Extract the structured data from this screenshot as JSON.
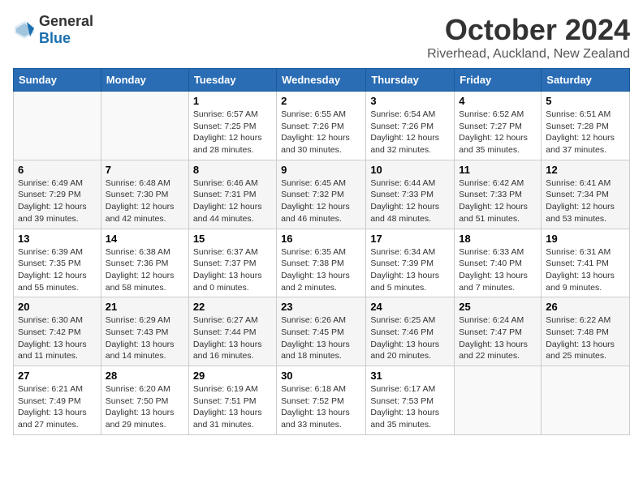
{
  "header": {
    "logo_general": "General",
    "logo_blue": "Blue",
    "title": "October 2024",
    "location": "Riverhead, Auckland, New Zealand"
  },
  "weekdays": [
    "Sunday",
    "Monday",
    "Tuesday",
    "Wednesday",
    "Thursday",
    "Friday",
    "Saturday"
  ],
  "weeks": [
    [
      {
        "day": "",
        "info": ""
      },
      {
        "day": "",
        "info": ""
      },
      {
        "day": "1",
        "info": "Sunrise: 6:57 AM\nSunset: 7:25 PM\nDaylight: 12 hours\nand 28 minutes."
      },
      {
        "day": "2",
        "info": "Sunrise: 6:55 AM\nSunset: 7:26 PM\nDaylight: 12 hours\nand 30 minutes."
      },
      {
        "day": "3",
        "info": "Sunrise: 6:54 AM\nSunset: 7:26 PM\nDaylight: 12 hours\nand 32 minutes."
      },
      {
        "day": "4",
        "info": "Sunrise: 6:52 AM\nSunset: 7:27 PM\nDaylight: 12 hours\nand 35 minutes."
      },
      {
        "day": "5",
        "info": "Sunrise: 6:51 AM\nSunset: 7:28 PM\nDaylight: 12 hours\nand 37 minutes."
      }
    ],
    [
      {
        "day": "6",
        "info": "Sunrise: 6:49 AM\nSunset: 7:29 PM\nDaylight: 12 hours\nand 39 minutes."
      },
      {
        "day": "7",
        "info": "Sunrise: 6:48 AM\nSunset: 7:30 PM\nDaylight: 12 hours\nand 42 minutes."
      },
      {
        "day": "8",
        "info": "Sunrise: 6:46 AM\nSunset: 7:31 PM\nDaylight: 12 hours\nand 44 minutes."
      },
      {
        "day": "9",
        "info": "Sunrise: 6:45 AM\nSunset: 7:32 PM\nDaylight: 12 hours\nand 46 minutes."
      },
      {
        "day": "10",
        "info": "Sunrise: 6:44 AM\nSunset: 7:33 PM\nDaylight: 12 hours\nand 48 minutes."
      },
      {
        "day": "11",
        "info": "Sunrise: 6:42 AM\nSunset: 7:33 PM\nDaylight: 12 hours\nand 51 minutes."
      },
      {
        "day": "12",
        "info": "Sunrise: 6:41 AM\nSunset: 7:34 PM\nDaylight: 12 hours\nand 53 minutes."
      }
    ],
    [
      {
        "day": "13",
        "info": "Sunrise: 6:39 AM\nSunset: 7:35 PM\nDaylight: 12 hours\nand 55 minutes."
      },
      {
        "day": "14",
        "info": "Sunrise: 6:38 AM\nSunset: 7:36 PM\nDaylight: 12 hours\nand 58 minutes."
      },
      {
        "day": "15",
        "info": "Sunrise: 6:37 AM\nSunset: 7:37 PM\nDaylight: 13 hours\nand 0 minutes."
      },
      {
        "day": "16",
        "info": "Sunrise: 6:35 AM\nSunset: 7:38 PM\nDaylight: 13 hours\nand 2 minutes."
      },
      {
        "day": "17",
        "info": "Sunrise: 6:34 AM\nSunset: 7:39 PM\nDaylight: 13 hours\nand 5 minutes."
      },
      {
        "day": "18",
        "info": "Sunrise: 6:33 AM\nSunset: 7:40 PM\nDaylight: 13 hours\nand 7 minutes."
      },
      {
        "day": "19",
        "info": "Sunrise: 6:31 AM\nSunset: 7:41 PM\nDaylight: 13 hours\nand 9 minutes."
      }
    ],
    [
      {
        "day": "20",
        "info": "Sunrise: 6:30 AM\nSunset: 7:42 PM\nDaylight: 13 hours\nand 11 minutes."
      },
      {
        "day": "21",
        "info": "Sunrise: 6:29 AM\nSunset: 7:43 PM\nDaylight: 13 hours\nand 14 minutes."
      },
      {
        "day": "22",
        "info": "Sunrise: 6:27 AM\nSunset: 7:44 PM\nDaylight: 13 hours\nand 16 minutes."
      },
      {
        "day": "23",
        "info": "Sunrise: 6:26 AM\nSunset: 7:45 PM\nDaylight: 13 hours\nand 18 minutes."
      },
      {
        "day": "24",
        "info": "Sunrise: 6:25 AM\nSunset: 7:46 PM\nDaylight: 13 hours\nand 20 minutes."
      },
      {
        "day": "25",
        "info": "Sunrise: 6:24 AM\nSunset: 7:47 PM\nDaylight: 13 hours\nand 22 minutes."
      },
      {
        "day": "26",
        "info": "Sunrise: 6:22 AM\nSunset: 7:48 PM\nDaylight: 13 hours\nand 25 minutes."
      }
    ],
    [
      {
        "day": "27",
        "info": "Sunrise: 6:21 AM\nSunset: 7:49 PM\nDaylight: 13 hours\nand 27 minutes."
      },
      {
        "day": "28",
        "info": "Sunrise: 6:20 AM\nSunset: 7:50 PM\nDaylight: 13 hours\nand 29 minutes."
      },
      {
        "day": "29",
        "info": "Sunrise: 6:19 AM\nSunset: 7:51 PM\nDaylight: 13 hours\nand 31 minutes."
      },
      {
        "day": "30",
        "info": "Sunrise: 6:18 AM\nSunset: 7:52 PM\nDaylight: 13 hours\nand 33 minutes."
      },
      {
        "day": "31",
        "info": "Sunrise: 6:17 AM\nSunset: 7:53 PM\nDaylight: 13 hours\nand 35 minutes."
      },
      {
        "day": "",
        "info": ""
      },
      {
        "day": "",
        "info": ""
      }
    ]
  ]
}
